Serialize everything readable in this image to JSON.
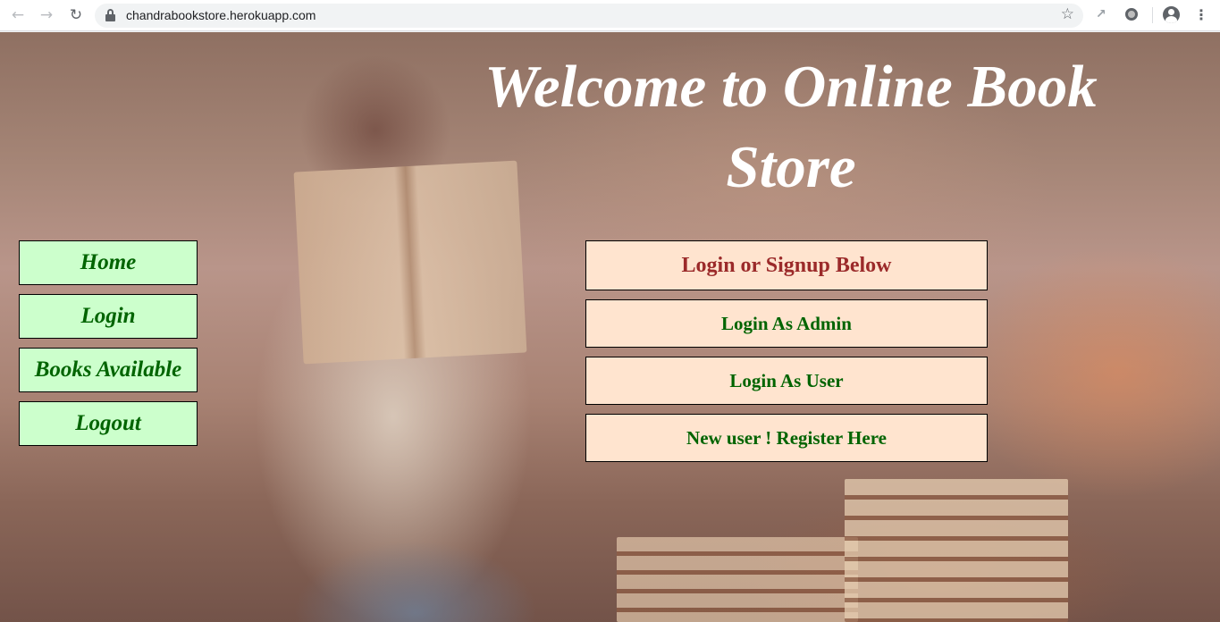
{
  "browser": {
    "url": "chandrabookstore.herokuapp.com",
    "icons": {
      "back": "back-arrow-icon",
      "forward": "forward-arrow-icon",
      "reload": "reload-icon",
      "lock": "lock-icon",
      "bookmark": "star-icon",
      "extension1": "extension-icon",
      "extension2": "extension-circle-icon",
      "profile": "profile-avatar-icon",
      "menu": "kebab-menu-icon"
    }
  },
  "page": {
    "title": "Welcome to Online Book Store",
    "colors": {
      "nav_bg": "#ccffcc",
      "nav_text": "#006400",
      "panel_bg": "#ffe4cf",
      "panel_head_text": "#9b2a2a",
      "panel_btn_text": "#006400"
    }
  },
  "nav": {
    "items": [
      {
        "label": "Home"
      },
      {
        "label": "Login"
      },
      {
        "label": "Books Available"
      },
      {
        "label": "Logout"
      }
    ]
  },
  "panel": {
    "heading": "Login or Signup Below",
    "buttons": [
      {
        "label": "Login As Admin"
      },
      {
        "label": "Login As User"
      },
      {
        "label": "New user ! Register Here"
      }
    ]
  }
}
